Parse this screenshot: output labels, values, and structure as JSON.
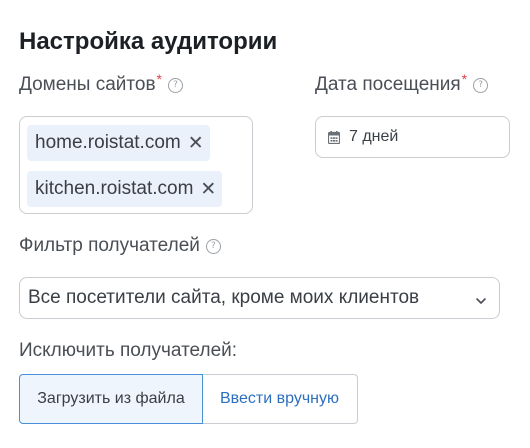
{
  "title": "Настройка аудитории",
  "domains": {
    "label": "Домены сайтов",
    "required_mark": "*",
    "tags": [
      {
        "text": "home.roistat.com",
        "remove": "✕"
      },
      {
        "text": "kitchen.roistat.com",
        "remove": "✕"
      }
    ]
  },
  "visit_date": {
    "label": "Дата посещения",
    "required_mark": "*",
    "value": "7 дней"
  },
  "recipient_filter": {
    "label": "Фильтр получателей",
    "selected": "Все посетители сайта, кроме моих клиентов"
  },
  "exclude": {
    "label": "Исключить получателей:",
    "options": [
      {
        "label": "Загрузить из файла",
        "active": true
      },
      {
        "label": "Ввести вручную",
        "active": false
      }
    ]
  },
  "help_icon_glyph": "?",
  "colors": {
    "accent": "#4a90d9",
    "link": "#2c6fbf",
    "required": "#e0424b",
    "tag_bg": "#eaf1fb",
    "border": "#c9ccd1"
  },
  "icons": [
    "help-icon",
    "calendar-icon",
    "close-icon",
    "chevron-down-icon"
  ]
}
